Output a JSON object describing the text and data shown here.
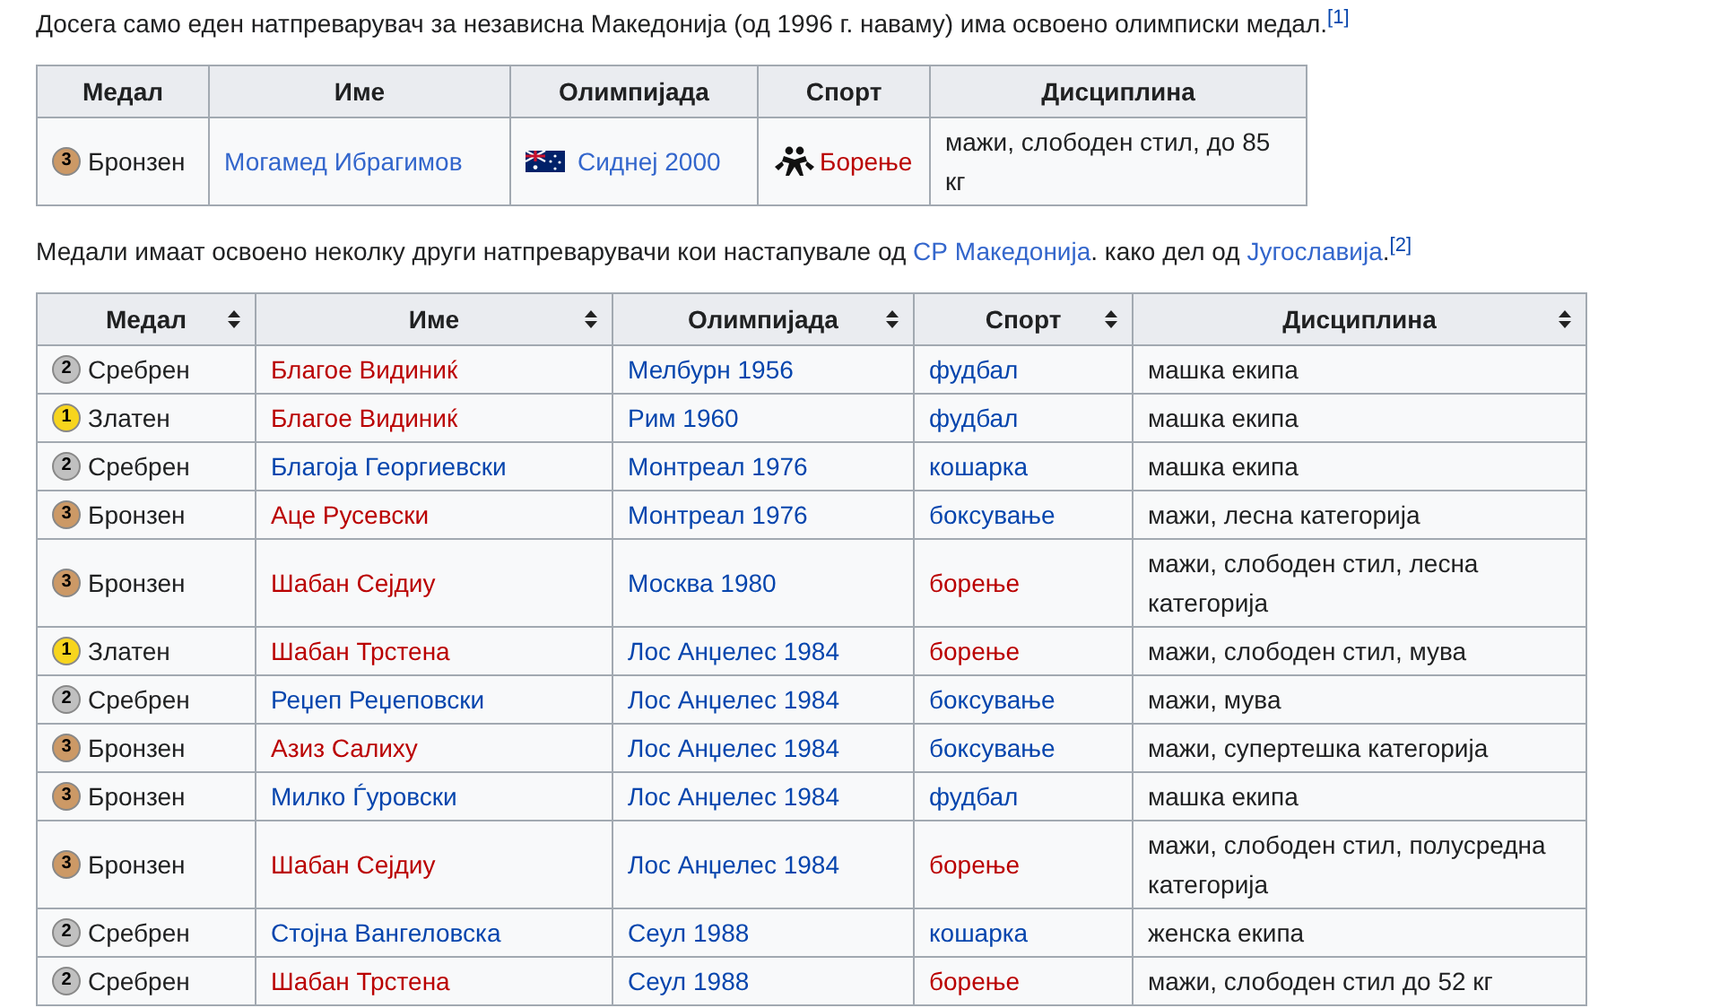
{
  "intro": {
    "text": "Досега само еден натпреварувач за независна Македонија (од 1996 г. наваму) има освоено олимписки медал.",
    "ref": "[1]"
  },
  "table1": {
    "columns": [
      "Медал",
      "Име",
      "Олимпијада",
      "Спорт",
      "Дисциплина"
    ],
    "rows": [
      {
        "medal": {
          "kind": "bronze",
          "number": "3",
          "label": "Бронзен"
        },
        "name": {
          "text": "Могамед Ибрагимов",
          "color": "#3366cc"
        },
        "olympics": {
          "text": "Сиднеј 2000",
          "color": "#3366cc"
        },
        "sport": {
          "text": "Борење",
          "color": "#ba0000"
        },
        "discipline": "мажи, слободен стил, до 85 кг"
      }
    ]
  },
  "paragraph2": {
    "parts": [
      {
        "kind": "text",
        "text": "Медали имаат освоено неколку други натпреварувачи кои настапувале од"
      },
      {
        "kind": "link",
        "text": "СР Македонија"
      },
      {
        "kind": "text",
        "text": ". како дел од"
      },
      {
        "kind": "link",
        "text": "Југославија"
      },
      {
        "kind": "text",
        "text": "."
      },
      {
        "kind": "ref",
        "text": "[2]"
      }
    ]
  },
  "table2": {
    "columns": [
      "Медал",
      "Име",
      "Олимпијада",
      "Спорт",
      "Дисциплина"
    ],
    "rows": [
      {
        "medal": {
          "kind": "silver",
          "number": "2",
          "label": "Сребрен"
        },
        "name": {
          "text": "Благое Видиниќ",
          "color": "#ba0000"
        },
        "olympics": {
          "text": "Мелбурн 1956",
          "color": "#0645ad"
        },
        "sport": {
          "text": "фудбал",
          "color": "#0645ad"
        },
        "discipline": "машка екипа"
      },
      {
        "medal": {
          "kind": "gold",
          "number": "1",
          "label": "Златен"
        },
        "name": {
          "text": "Благое Видиниќ",
          "color": "#ba0000"
        },
        "olympics": {
          "text": "Рим 1960",
          "color": "#0645ad"
        },
        "sport": {
          "text": "фудбал",
          "color": "#0645ad"
        },
        "discipline": "машка екипа"
      },
      {
        "medal": {
          "kind": "silver",
          "number": "2",
          "label": "Сребрен"
        },
        "name": {
          "text": "Благоја Георгиевски",
          "color": "#0645ad"
        },
        "olympics": {
          "text": "Монтреал 1976",
          "color": "#0645ad"
        },
        "sport": {
          "text": "кошарка",
          "color": "#0645ad"
        },
        "discipline": "машка екипа"
      },
      {
        "medal": {
          "kind": "bronze",
          "number": "3",
          "label": "Бронзен"
        },
        "name": {
          "text": "Аце Русевски",
          "color": "#ba0000"
        },
        "olympics": {
          "text": "Монтреал 1976",
          "color": "#0645ad"
        },
        "sport": {
          "text": "боксување",
          "color": "#0645ad"
        },
        "discipline": "мажи, лесна категорија"
      },
      {
        "medal": {
          "kind": "bronze",
          "number": "3",
          "label": "Бронзен"
        },
        "name": {
          "text": "Шабан Сејдиу",
          "color": "#ba0000"
        },
        "olympics": {
          "text": "Москва 1980",
          "color": "#0645ad"
        },
        "sport": {
          "text": "борење",
          "color": "#ba0000"
        },
        "discipline": "мажи, слободен стил, лесна категорија"
      },
      {
        "medal": {
          "kind": "gold",
          "number": "1",
          "label": "Златен"
        },
        "name": {
          "text": "Шабан Трстена",
          "color": "#ba0000"
        },
        "olympics": {
          "text": "Лос Анџелес 1984",
          "color": "#0645ad"
        },
        "sport": {
          "text": "борење",
          "color": "#ba0000"
        },
        "discipline": "мажи, слободен стил, мува"
      },
      {
        "medal": {
          "kind": "silver",
          "number": "2",
          "label": "Сребрен"
        },
        "name": {
          "text": "Реџеп Реџеповски",
          "color": "#0645ad"
        },
        "olympics": {
          "text": "Лос Анџелес 1984",
          "color": "#0645ad"
        },
        "sport": {
          "text": "боксување",
          "color": "#0645ad"
        },
        "discipline": "мажи, мува"
      },
      {
        "medal": {
          "kind": "bronze",
          "number": "3",
          "label": "Бронзен"
        },
        "name": {
          "text": "Азиз Салиху",
          "color": "#ba0000"
        },
        "olympics": {
          "text": "Лос Анџелес 1984",
          "color": "#0645ad"
        },
        "sport": {
          "text": "боксување",
          "color": "#0645ad"
        },
        "discipline": "мажи, супертешка категорија"
      },
      {
        "medal": {
          "kind": "bronze",
          "number": "3",
          "label": "Бронзен"
        },
        "name": {
          "text": "Милко Ѓуровски",
          "color": "#0645ad"
        },
        "olympics": {
          "text": "Лос Анџелес 1984",
          "color": "#0645ad"
        },
        "sport": {
          "text": "фудбал",
          "color": "#0645ad"
        },
        "discipline": "машка екипа"
      },
      {
        "medal": {
          "kind": "bronze",
          "number": "3",
          "label": "Бронзен"
        },
        "name": {
          "text": "Шабан Сејдиу",
          "color": "#ba0000"
        },
        "olympics": {
          "text": "Лос Анџелес 1984",
          "color": "#0645ad"
        },
        "sport": {
          "text": "борење",
          "color": "#ba0000"
        },
        "discipline": "мажи, слободен стил, полусредна категорија"
      },
      {
        "medal": {
          "kind": "silver",
          "number": "2",
          "label": "Сребрен"
        },
        "name": {
          "text": "Стојна Вангеловска",
          "color": "#0645ad"
        },
        "olympics": {
          "text": "Сеул 1988",
          "color": "#0645ad"
        },
        "sport": {
          "text": "кошарка",
          "color": "#0645ad"
        },
        "discipline": "женска екипа"
      },
      {
        "medal": {
          "kind": "silver",
          "number": "2",
          "label": "Сребрен"
        },
        "name": {
          "text": "Шабан Трстена",
          "color": "#ba0000"
        },
        "olympics": {
          "text": "Сеул 1988",
          "color": "#0645ad"
        },
        "sport": {
          "text": "борење",
          "color": "#ba0000"
        },
        "discipline": "мажи, слободен стил до 52 кг"
      }
    ]
  }
}
